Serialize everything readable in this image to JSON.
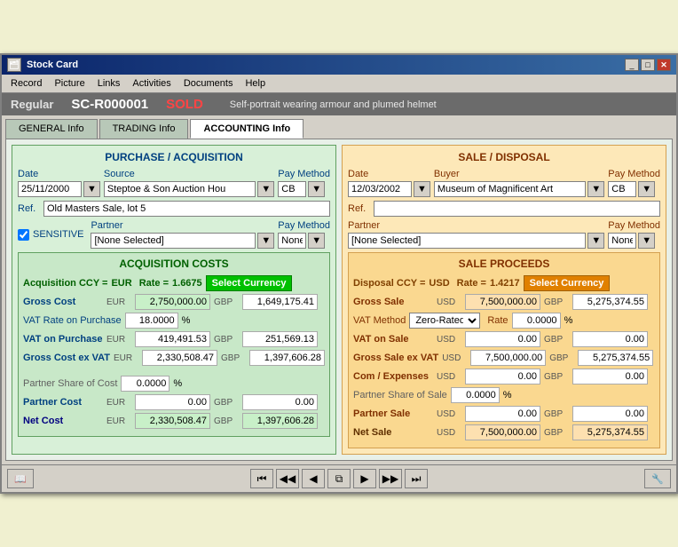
{
  "window": {
    "title": "Stock Card",
    "icon": "📋"
  },
  "menubar": {
    "items": [
      "Record",
      "Picture",
      "Links",
      "Activities",
      "Documents",
      "Help"
    ]
  },
  "header": {
    "type": "Regular",
    "code": "SC-R000001",
    "status": "SOLD",
    "description": "Self-portrait wearing armour and plumed helmet"
  },
  "tabs": [
    {
      "label": "GENERAL Info",
      "active": false
    },
    {
      "label": "TRADING Info",
      "active": false
    },
    {
      "label": "ACCOUNTING Info",
      "active": true
    }
  ],
  "acquisition": {
    "title": "PURCHASE / ACQUISITION",
    "date_label": "Date",
    "date_value": "25/11/2000",
    "source_label": "Source",
    "source_value": "Steptoe & Son Auction Hou",
    "pay_method_label": "Pay Method",
    "pay_method_value": "CB",
    "ref_label": "Ref.",
    "ref_value": "Old Masters Sale, lot 5",
    "partner_label": "Partner",
    "partner_value": "[None Selected]",
    "partner_pay_label": "Pay Method",
    "partner_pay_value": "None",
    "sensitive_label": "SENSITIVE",
    "sensitive_checked": true
  },
  "acquisition_costs": {
    "title": "ACQUISITION COSTS",
    "ccy_label": "Acquisition CCY =",
    "ccy_value": "EUR",
    "rate_label": "Rate =",
    "rate_value": "1.6675",
    "select_currency": "Select Currency",
    "gross_cost_label": "Gross Cost",
    "gross_cost_eur": "2,750,000.00",
    "gross_cost_gbp": "1,649,175.41",
    "vat_rate_label": "VAT Rate on Purchase",
    "vat_rate_value": "18.0000",
    "vat_pct": "%",
    "vat_on_purchase_label": "VAT on Purchase",
    "vat_eur": "419,491.53",
    "vat_gbp": "251,569.13",
    "gross_ex_vat_label": "Gross Cost ex VAT",
    "gross_ex_vat_eur": "2,330,508.47",
    "gross_ex_vat_gbp": "1,397,606.28",
    "partner_share_label": "Partner Share of Cost",
    "partner_share_value": "0.0000",
    "partner_share_pct": "%",
    "partner_cost_label": "Partner Cost",
    "partner_cost_eur": "0.00",
    "partner_cost_gbp": "0.00",
    "net_cost_label": "Net Cost",
    "net_cost_eur": "2,330,508.47",
    "net_cost_gbp": "1,397,606.28"
  },
  "sale": {
    "title": "SALE / DISPOSAL",
    "date_label": "Date",
    "date_value": "12/03/2002",
    "buyer_label": "Buyer",
    "buyer_value": "Museum of Magnificent Art",
    "pay_method_label": "Pay Method",
    "pay_method_value": "CB",
    "ref_label": "Ref.",
    "ref_value": "",
    "partner_label": "Partner",
    "partner_value": "[None Selected]",
    "partner_pay_label": "Pay Method",
    "partner_pay_value": "None"
  },
  "sale_proceeds": {
    "title": "SALE PROCEEDS",
    "ccy_label": "Disposal CCY =",
    "ccy_value": "USD",
    "rate_label": "Rate =",
    "rate_value": "1.4217",
    "select_currency": "Select Currency",
    "gross_sale_label": "Gross Sale",
    "gross_sale_usd": "7,500,000.00",
    "gross_sale_gbp": "5,275,374.55",
    "vat_method_label": "VAT Method",
    "vat_method_value": "Zero-Rated",
    "rate_label2": "Rate",
    "rate_value2": "0.0000",
    "vat_pct": "%",
    "vat_on_sale_label": "VAT on Sale",
    "vat_usd": "0.00",
    "vat_gbp": "0.00",
    "gross_ex_vat_label": "Gross Sale ex VAT",
    "gross_ex_vat_usd": "7,500,000.00",
    "gross_ex_vat_gbp": "5,275,374.55",
    "com_expenses_label": "Com / Expenses",
    "com_usd": "0.00",
    "com_gbp": "0.00",
    "partner_share_label": "Partner Share of Sale",
    "partner_share_value": "0.0000",
    "partner_share_pct": "%",
    "partner_sale_label": "Partner Sale",
    "partner_usd": "0.00",
    "partner_gbp": "0.00",
    "net_sale_label": "Net Sale",
    "net_sale_usd": "7,500,000.00",
    "net_sale_gbp": "5,275,374.55"
  },
  "nav": {
    "first": "⏮",
    "prev_far": "◀◀",
    "prev": "◀",
    "copy": "⧉",
    "next": "▶",
    "next_far": "▶▶",
    "last": "⏭",
    "book": "📖",
    "tools": "🔧"
  }
}
